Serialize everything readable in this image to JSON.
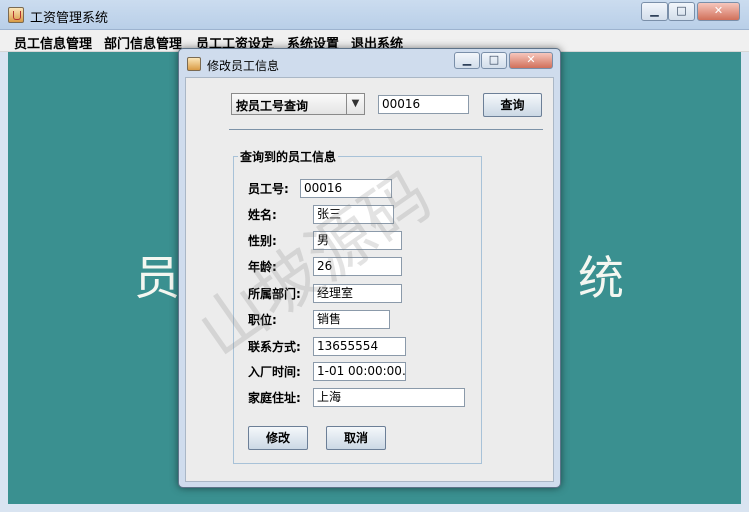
{
  "outer_window": {
    "title": "工资管理系统",
    "controls": {
      "minimize": "▁",
      "maximize": "□",
      "close": "✕"
    }
  },
  "menu": [
    {
      "label": "员工信息管理"
    },
    {
      "label": "部门信息管理"
    },
    {
      "label": "员工工资设定"
    },
    {
      "label": "系统设置"
    },
    {
      "label": "退出系统"
    }
  ],
  "background_title": {
    "left": "员",
    "right": "统"
  },
  "dialog": {
    "title": "修改员工信息",
    "controls": {
      "minimize": "▁",
      "maximize": "□",
      "close": "✕"
    },
    "query": {
      "mode_selected": "按员工号查询",
      "arrow": "▼",
      "input_value": "00016",
      "button_label": "查询"
    },
    "result_group": {
      "title": "查询到的员工信息",
      "fields": {
        "emp_id": {
          "label": "员工号:",
          "value": "00016"
        },
        "name": {
          "label": "姓名:",
          "value": "张三"
        },
        "gender": {
          "label": "性别:",
          "value": "男"
        },
        "age": {
          "label": "年龄:",
          "value": "26"
        },
        "department": {
          "label": "所属部门:",
          "value": "经理室"
        },
        "position": {
          "label": "职位:",
          "value": "销售"
        },
        "phone": {
          "label": "联系方式:",
          "value": "13655554"
        },
        "hire_date": {
          "label": "入厂时间:",
          "value": "1-01 00:00:00.0"
        },
        "address": {
          "label": "家庭住址:",
          "value": "上海"
        }
      },
      "modify_button": "修改",
      "cancel_button": "取消"
    }
  },
  "watermark": "山坡源码",
  "colors": {
    "desktop": "#3a9090",
    "titlebar": "#c2d5ec",
    "dialog_body": "#ececec"
  }
}
